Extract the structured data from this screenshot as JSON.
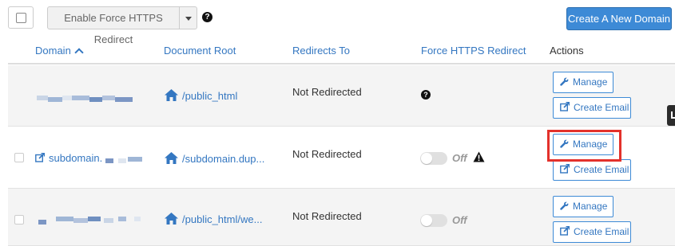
{
  "toolbar": {
    "https_button_label": "Enable Force HTTPS Redirect",
    "create_button_label": "Create A New Domain"
  },
  "table": {
    "columns": [
      "Domain",
      "Document Root",
      "Redirects To",
      "Force HTTPS Redirect",
      "Actions"
    ],
    "rows": [
      {
        "domain": "",
        "domain_redacted": true,
        "document_root": "/public_html",
        "redirects_to": "Not Redirected",
        "force_https": "help",
        "manage_label": "Manage",
        "create_email_label": "Create Email"
      },
      {
        "domain": "subdomain.",
        "domain_redacted": true,
        "document_root": "/subdomain.dup...",
        "redirects_to": "Not Redirected",
        "force_https": "Off",
        "manage_label": "Manage",
        "create_email_label": "Create Email"
      },
      {
        "domain": "",
        "domain_redacted": true,
        "document_root": "/public_html/we...",
        "redirects_to": "Not Redirected",
        "force_https": "Off",
        "manage_label": "Manage",
        "create_email_label": "Create Email"
      }
    ]
  },
  "colors": {
    "accent": "#3477c1",
    "primary_button": "#3d8ad6",
    "highlight": "#e3312b",
    "row_shaded": "#f4f4f4"
  },
  "icons": [
    "help-icon",
    "home-icon",
    "external-link-icon",
    "wrench-icon",
    "edit-icon",
    "warning-icon",
    "caret-down-icon",
    "sort-up-icon"
  ]
}
